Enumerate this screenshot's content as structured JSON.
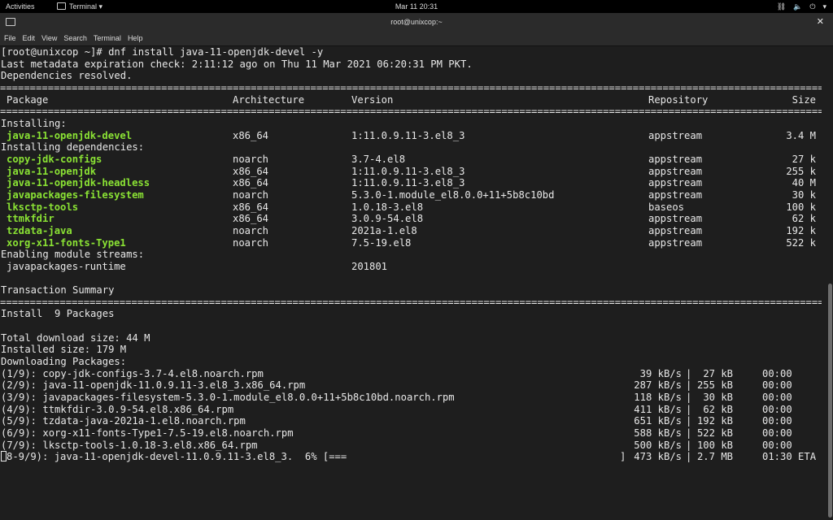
{
  "topbar": {
    "activities": "Activities",
    "app_menu": "Terminal ▾",
    "clock": "Mar 11  20:31",
    "network_icon": "network-icon",
    "volume_icon": "volume-icon",
    "power_icon": "power-icon",
    "menu_arrow": "▾"
  },
  "window": {
    "title": "root@unixcop:~",
    "close": "✕"
  },
  "menu": [
    "File",
    "Edit",
    "View",
    "Search",
    "Terminal",
    "Help"
  ],
  "terminal": {
    "prompt": "[root@unixcop ~]# dnf install java-11-openjdk-devel -y",
    "metadata": "Last metadata expiration check: 2:11:12 ago on Thu 11 Mar 2021 06:20:31 PM PKT.",
    "resolved": "Dependencies resolved.",
    "separator": "==================================================================================================================================================================",
    "headers": {
      "package": "Package",
      "arch": "Architecture",
      "version": "Version",
      "repo": "Repository",
      "size": "Size"
    },
    "installing_label": "Installing:",
    "installing": [
      {
        "name": "java-11-openjdk-devel",
        "arch": "x86_64",
        "version": "1:11.0.9.11-3.el8_3",
        "repo": "appstream",
        "size": "3.4 M"
      }
    ],
    "deps_label": "Installing dependencies:",
    "deps": [
      {
        "name": "copy-jdk-configs",
        "arch": "noarch",
        "version": "3.7-4.el8",
        "repo": "appstream",
        "size": "27 k"
      },
      {
        "name": "java-11-openjdk",
        "arch": "x86_64",
        "version": "1:11.0.9.11-3.el8_3",
        "repo": "appstream",
        "size": "255 k"
      },
      {
        "name": "java-11-openjdk-headless",
        "arch": "x86_64",
        "version": "1:11.0.9.11-3.el8_3",
        "repo": "appstream",
        "size": "40 M"
      },
      {
        "name": "javapackages-filesystem",
        "arch": "noarch",
        "version": "5.3.0-1.module_el8.0.0+11+5b8c10bd",
        "repo": "appstream",
        "size": "30 k"
      },
      {
        "name": "lksctp-tools",
        "arch": "x86_64",
        "version": "1.0.18-3.el8",
        "repo": "baseos",
        "size": "100 k"
      },
      {
        "name": "ttmkfdir",
        "arch": "x86_64",
        "version": "3.0.9-54.el8",
        "repo": "appstream",
        "size": "62 k"
      },
      {
        "name": "tzdata-java",
        "arch": "noarch",
        "version": "2021a-1.el8",
        "repo": "appstream",
        "size": "192 k"
      },
      {
        "name": "xorg-x11-fonts-Type1",
        "arch": "noarch",
        "version": "7.5-19.el8",
        "repo": "appstream",
        "size": "522 k"
      }
    ],
    "modules_label": "Enabling module streams:",
    "modules": [
      {
        "name": "javapackages-runtime",
        "version": "201801"
      }
    ],
    "summary_label": "Transaction Summary",
    "install_line": "Install  9 Packages",
    "total_download": "Total download size: 44 M",
    "installed_size": "Installed size: 179 M",
    "downloading_label": "Downloading Packages:",
    "downloads": [
      {
        "file": "(1/9): copy-jdk-configs-3.7-4.el8.noarch.rpm",
        "speed": "39 kB/s",
        "size": "27 kB",
        "time": "00:00"
      },
      {
        "file": "(2/9): java-11-openjdk-11.0.9.11-3.el8_3.x86_64.rpm",
        "speed": "287 kB/s",
        "size": "255 kB",
        "time": "00:00"
      },
      {
        "file": "(3/9): javapackages-filesystem-5.3.0-1.module_el8.0.0+11+5b8c10bd.noarch.rpm",
        "speed": "118 kB/s",
        "size": "30 kB",
        "time": "00:00"
      },
      {
        "file": "(4/9): ttmkfdir-3.0.9-54.el8.x86_64.rpm",
        "speed": "411 kB/s",
        "size": "62 kB",
        "time": "00:00"
      },
      {
        "file": "(5/9): tzdata-java-2021a-1.el8.noarch.rpm",
        "speed": "651 kB/s",
        "size": "192 kB",
        "time": "00:00"
      },
      {
        "file": "(6/9): xorg-x11-fonts-Type1-7.5-19.el8.noarch.rpm",
        "speed": "588 kB/s",
        "size": "522 kB",
        "time": "00:00"
      },
      {
        "file": "(7/9): lksctp-tools-1.0.18-3.el8.x86_64.rpm",
        "speed": "500 kB/s",
        "size": "100 kB",
        "time": "00:00"
      }
    ],
    "progress": {
      "file": "8-9/9): java-11-openjdk-devel-11.0.9.11-3.el8_3.  6% [===",
      "bar_end": "]",
      "speed": "473 kB/s",
      "size": "2.7 MB",
      "time": "01:30 ETA"
    },
    "pipe": "|"
  }
}
